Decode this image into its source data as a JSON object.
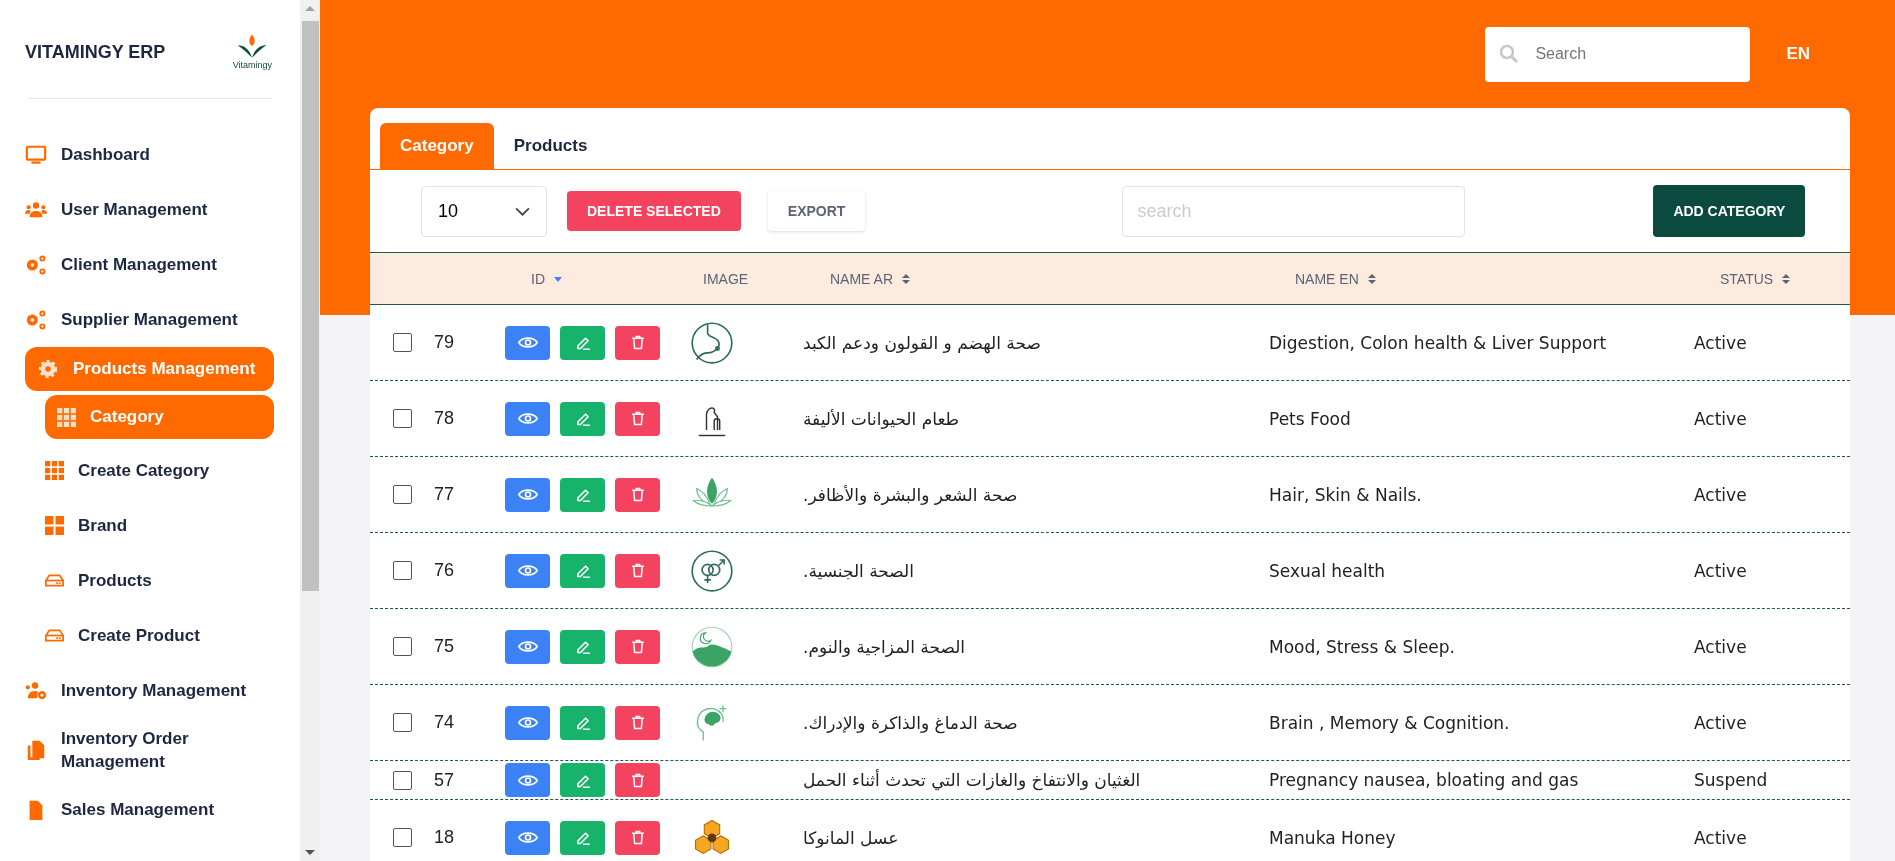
{
  "sidebar": {
    "title": "VITAMINGY ERP",
    "logo_text": "Vitamingy",
    "items": [
      {
        "label": "Dashboard",
        "kind": "monitor",
        "selected": false
      },
      {
        "label": "User Management",
        "kind": "users",
        "selected": false
      },
      {
        "label": "Client Management",
        "kind": "gears",
        "selected": false
      },
      {
        "label": "Supplier Management",
        "kind": "gears",
        "selected": false
      },
      {
        "label": "Products Management",
        "kind": "gear",
        "selected": true,
        "children": [
          {
            "label": "Category",
            "kind": "grid",
            "selected": true
          },
          {
            "label": "Create Category",
            "kind": "grid",
            "selected": false
          },
          {
            "label": "Brand",
            "kind": "squares",
            "selected": false
          },
          {
            "label": "Products",
            "kind": "drive",
            "selected": false
          },
          {
            "label": "Create Product",
            "kind": "drive",
            "selected": false
          }
        ]
      },
      {
        "label": "Inventory Management",
        "kind": "usergear",
        "selected": false
      },
      {
        "label": "Inventory Order Management",
        "kind": "files",
        "selected": false
      },
      {
        "label": "Sales Management",
        "kind": "file",
        "selected": false
      }
    ]
  },
  "header": {
    "search": {
      "placeholder": "Search"
    },
    "language": "EN"
  },
  "tabs": [
    {
      "label": "Category",
      "selected": true
    },
    {
      "label": "Products",
      "selected": false
    }
  ],
  "toolbar": {
    "page_size": "10",
    "delete_button": "DELETE SELECTED",
    "export_button": "EXPORT",
    "search": {
      "placeholder": "search"
    },
    "add_button": "ADD CATEGORY"
  },
  "table": {
    "columns": [
      {
        "label": "ID",
        "kind": "desc"
      },
      {
        "label": "IMAGE",
        "kind": "none"
      },
      {
        "label": "NAME AR",
        "kind": "both"
      },
      {
        "label": "NAME EN",
        "kind": "both"
      },
      {
        "label": "STATUS",
        "kind": "both"
      }
    ],
    "rows": [
      {
        "checked": false,
        "id": "79",
        "kind": "stomach",
        "name_ar": "صحة الهضم و القولون ودعم الكبد",
        "name_en": "Digestion, Colon health & Liver Support",
        "status": "Active"
      },
      {
        "checked": false,
        "id": "78",
        "kind": "pets",
        "name_ar": "طعام الحيوانات الأليفة",
        "name_en": "Pets Food",
        "status": "Active"
      },
      {
        "checked": false,
        "id": "77",
        "kind": "lotus",
        "name_ar": "صحة الشعر والبشرة والأظافر.",
        "name_en": "Hair, Skin & Nails.",
        "status": "Active"
      },
      {
        "checked": false,
        "id": "76",
        "kind": "gender",
        "name_ar": "الصحة الجنسية.",
        "name_en": "Sexual health",
        "status": "Active"
      },
      {
        "checked": false,
        "id": "75",
        "kind": "sleep",
        "name_ar": "الصحة المزاجية والنوم.",
        "name_en": "Mood, Stress & Sleep.",
        "status": "Active"
      },
      {
        "checked": false,
        "id": "74",
        "kind": "brain",
        "name_ar": "صحة الدماغ والذاكرة والإدراك.",
        "name_en": "Brain , Memory & Cognition.",
        "status": "Active"
      },
      {
        "checked": false,
        "id": "57",
        "name_ar": "الغثيان والانتفاخ والغازات التي تحدث أثناء الحمل",
        "name_en": "Pregnancy nausea, bloating and gas",
        "status": "Suspend"
      },
      {
        "checked": false,
        "id": "18",
        "kind": "honey",
        "name_ar": "عسل المانوكا",
        "name_en": "Manuka Honey",
        "status": "Active"
      }
    ]
  }
}
